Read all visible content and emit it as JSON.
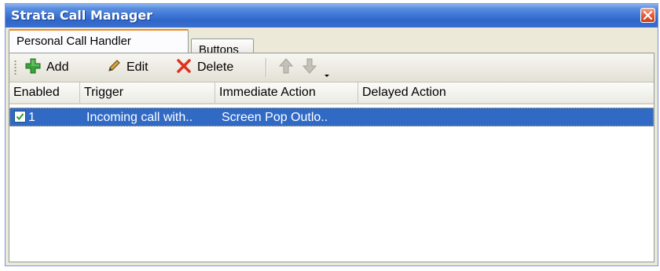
{
  "window": {
    "title": "Strata Call Manager"
  },
  "tabs": [
    {
      "label": "Personal Call Handler",
      "active": true
    },
    {
      "label": "Buttons",
      "active": false
    }
  ],
  "toolbar": {
    "add_label": "Add",
    "edit_label": "Edit",
    "delete_label": "Delete",
    "add_icon": "plus-icon",
    "edit_icon": "pencil-icon",
    "delete_icon": "x-icon",
    "move_up_icon": "arrow-up-icon",
    "move_down_icon": "arrow-down-icon",
    "overflow_icon": "chevron-down-icon"
  },
  "grid": {
    "columns": [
      "Enabled",
      "Trigger",
      "Immediate Action",
      "Delayed Action"
    ],
    "rows": [
      {
        "enabled": true,
        "index": "1",
        "trigger": "Incoming call with..",
        "immediate_action": "Screen Pop Outlo..",
        "delayed_action": ""
      }
    ]
  },
  "colors": {
    "titlebar": "#2f66c8",
    "selection": "#316ac5",
    "active_tab_accent": "#e68b2c",
    "add_icon": "#3aa33a",
    "delete_icon": "#e0301e"
  }
}
